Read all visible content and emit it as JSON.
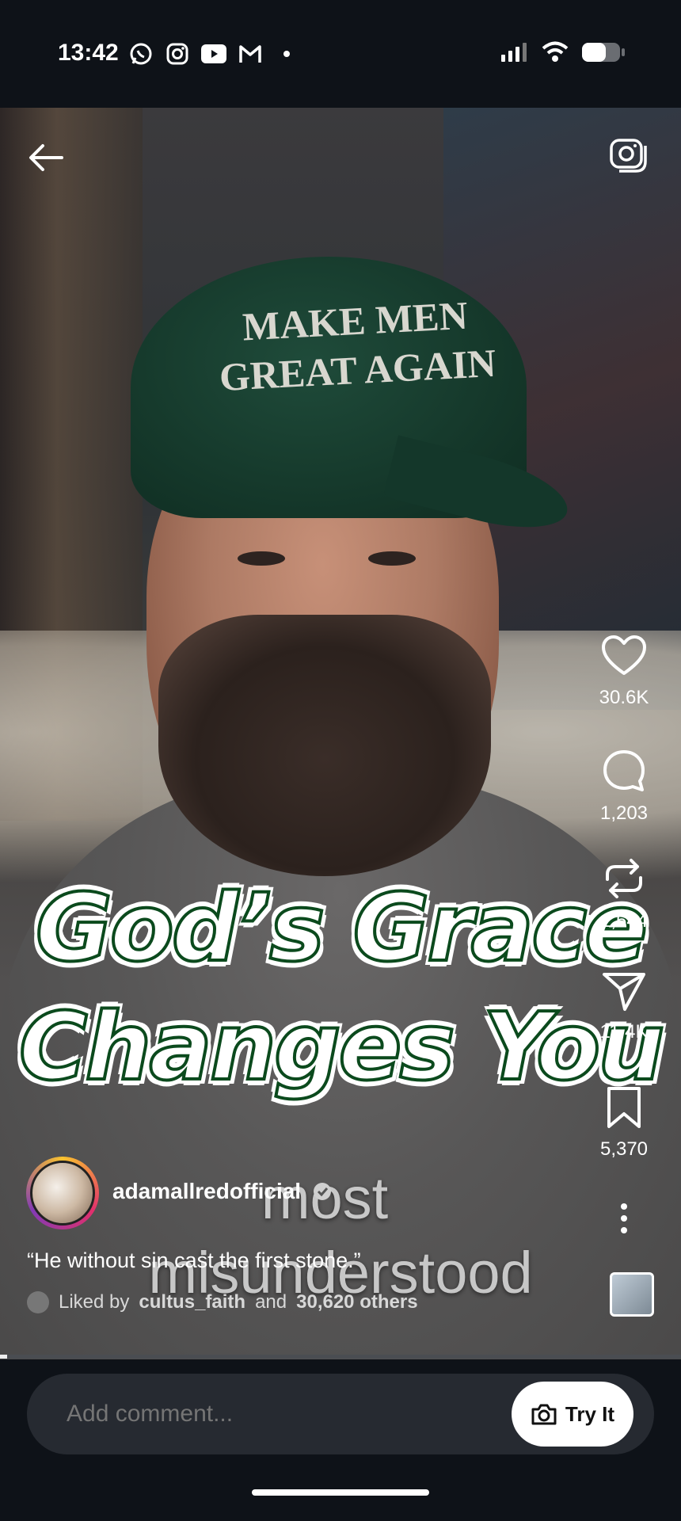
{
  "status": {
    "time": "13:42",
    "left_icons": [
      "whatsapp-icon",
      "instagram-icon",
      "youtube-icon",
      "gmail-icon",
      "dot-icon"
    ],
    "right_icons": [
      "signal-icon",
      "wifi-icon",
      "battery-icon"
    ]
  },
  "video": {
    "cap_text_line1": "MAKE MEN",
    "cap_text_line2": "GREAT AGAIN",
    "caption_line1": "God’s Grace",
    "caption_line2": "Changes You",
    "subtitle_line1": "most",
    "subtitle_line2": "misunderstood"
  },
  "rail": {
    "likes": "30.6K",
    "comments": "1,203",
    "reposts": "1,544",
    "shares": "11.4K",
    "saves": "5,370"
  },
  "post": {
    "username": "adamallredofficial",
    "description": "“He without sin cast the first stone.”",
    "liked_by_prefix": "Liked by",
    "liked_by_user": "cultus_faith",
    "liked_by_and": "and",
    "liked_by_others": "30,620 others"
  },
  "progress": 0.01,
  "comment": {
    "placeholder": "Add comment...",
    "try_it": "Try It"
  },
  "colors": {
    "caption_fill": "#ffffff",
    "caption_stroke": "#0b4a1d",
    "background": "#0e1218"
  }
}
